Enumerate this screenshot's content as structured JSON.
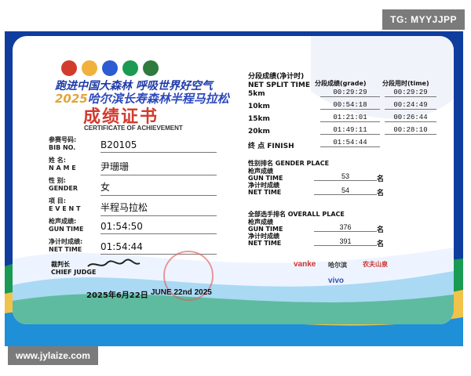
{
  "watermarks": {
    "top_right": "TG: MYYJJPP",
    "bottom_left": "www.jylaize.com"
  },
  "event": {
    "title_line1": "跑进中国大森林 呼吸世界好空气",
    "title_year": "2025",
    "title_line2": "哈尔滨长寿森林半程马拉松",
    "cert_title": "成绩证书",
    "cert_subtitle": "CERTIFICATE OF ACHIEVEMENT"
  },
  "runner": {
    "bib_label_cn": "参赛号码:",
    "bib_label_en": "BIB  NO.",
    "bib": "B20105",
    "name_label_cn": "姓       名:",
    "name_label_en": "N A M E",
    "name": "尹珊珊",
    "gender_label_cn": "性       别:",
    "gender_label_en": "GENDER",
    "gender": "女",
    "event_label_cn": "项       目:",
    "event_label_en": "E V E N T",
    "event": "半程马拉松",
    "gun_label_cn": "枪声成绩:",
    "gun_label_en": "GUN TIME",
    "gun_time": "01:54:50",
    "net_label_cn": "净计时成绩:",
    "net_label_en": "NET TIME",
    "net_time": "01:54:44"
  },
  "splits": {
    "title_cn": "分段成绩(净计时)",
    "title_en": "NET SPLIT TIME",
    "col_grade": "分段成绩(grade)",
    "col_time": "分段用时(time)",
    "rows": [
      {
        "km": "5km",
        "grade": "00:29:29",
        "time": "00:29:29"
      },
      {
        "km": "10km",
        "grade": "00:54:18",
        "time": "00:24:49"
      },
      {
        "km": "15km",
        "grade": "01:21:01",
        "time": "00:26:44"
      },
      {
        "km": "20km",
        "grade": "01:49:11",
        "time": "00:28:10"
      },
      {
        "km": "终 点 FINISH",
        "grade": "01:54:44",
        "time": ""
      }
    ]
  },
  "gender_place": {
    "title": "性别排名  GENDER PLACE",
    "gun_label_cn": "枪声成绩",
    "gun_label_en": "GUN TIME",
    "gun": "53",
    "net_label_cn": "净计时成绩",
    "net_label_en": "NET TIME",
    "net": "54",
    "unit": "名"
  },
  "overall_place": {
    "title": "全部选手排名 OVERALL PLACE",
    "gun_label_cn": "枪声成绩",
    "gun_label_en": "GUN TIME",
    "gun": "376",
    "net_label_cn": "净计时成绩",
    "net_label_en": "NET TIME",
    "net": "391",
    "unit": "名"
  },
  "judge": {
    "label_cn": "裁判长",
    "label_en": "CHIEF JUDGE"
  },
  "date": {
    "cn": "2025年6月22日",
    "en": "JUNE 22nd 2025"
  },
  "sponsors": {
    "vanke": "vanke",
    "harbin": "哈尔滨",
    "nongfu": "农夫山泉",
    "vivo": "vivo"
  }
}
